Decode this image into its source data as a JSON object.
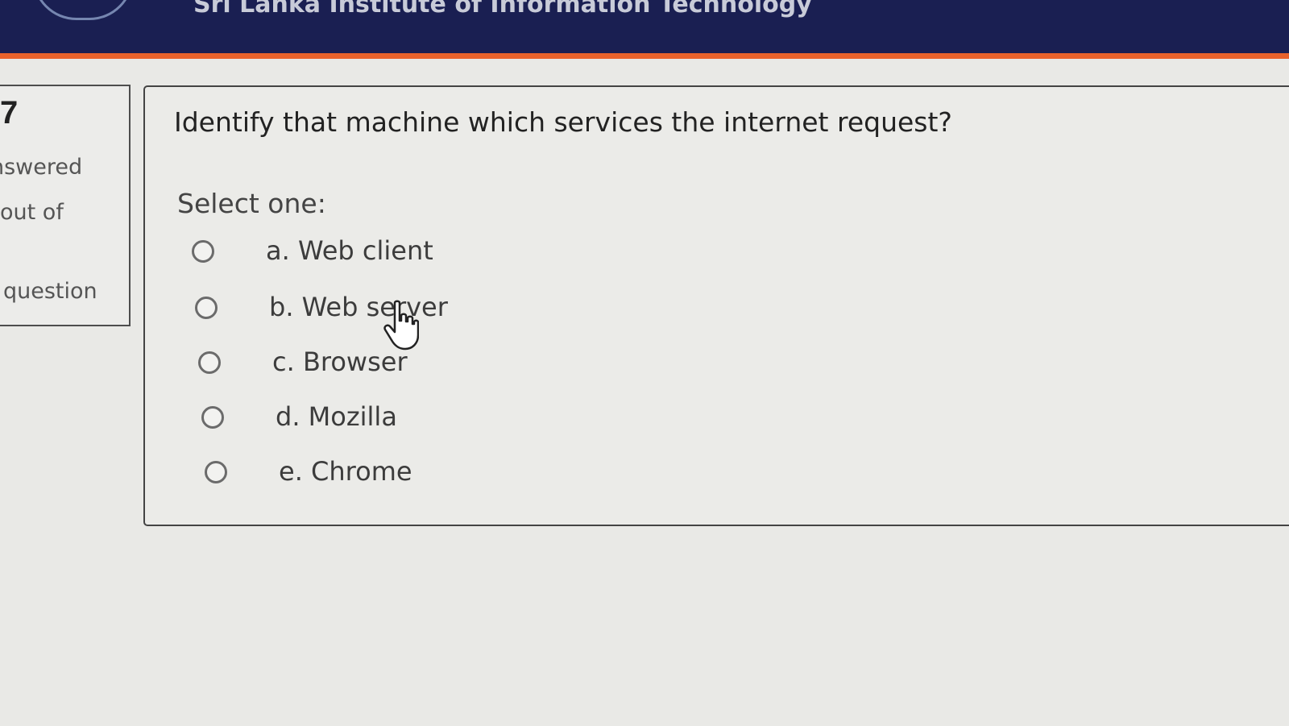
{
  "header": {
    "title": "Sri Lanka Institute of Information Technology"
  },
  "info": {
    "question_number": "7",
    "status": "nswered",
    "marks": "out of",
    "flag": "question"
  },
  "question": {
    "text": "Identify that machine which services the internet request?",
    "prompt": "Select one:",
    "options": [
      {
        "label": "a. Web client"
      },
      {
        "label": "b. Web server"
      },
      {
        "label": "c. Browser"
      },
      {
        "label": "d. Mozilla"
      },
      {
        "label": "e. Chrome"
      }
    ]
  },
  "colors": {
    "header_bg": "#1a1f52",
    "header_stripe": "#e8622c"
  },
  "icons": {
    "cursor": "hand-pointer-icon"
  }
}
